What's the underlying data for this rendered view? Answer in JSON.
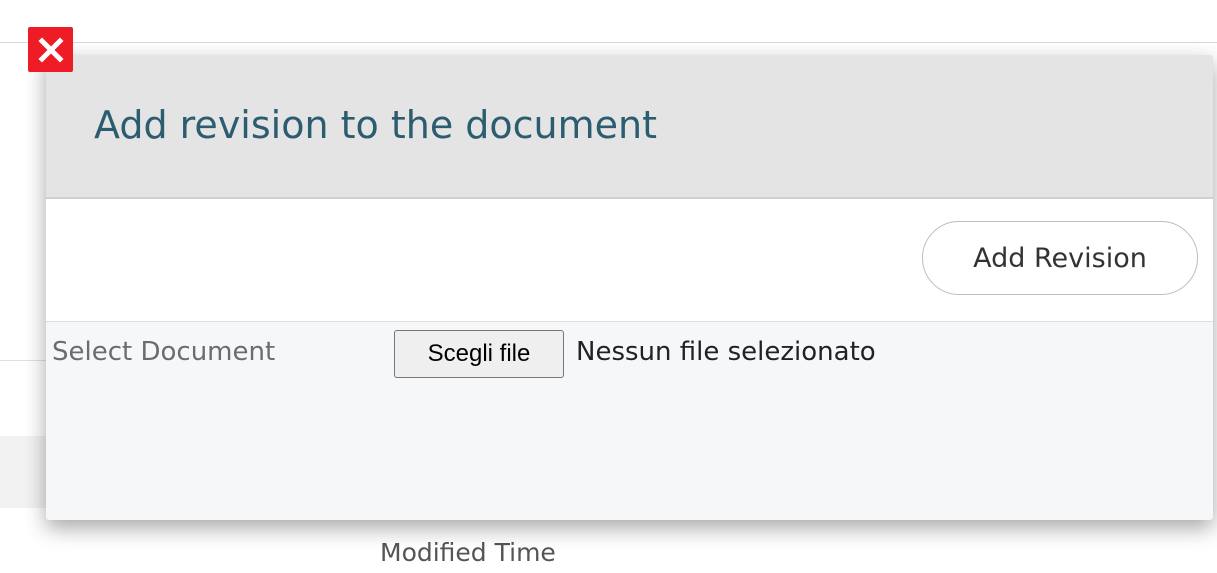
{
  "background": {
    "column_header": "Modified Time"
  },
  "close_button": {
    "icon": "close-icon",
    "color": "#ee1c25"
  },
  "modal": {
    "title": "Add revision to the document",
    "add_revision_label": "Add Revision",
    "form": {
      "select_label": "Select Document",
      "file_button_label": "Scegli file",
      "file_status": "Nessun file selezionato"
    }
  },
  "colors": {
    "title": "#2b5c70",
    "header_bg": "#e4e4e4",
    "body_bg": "#f6f7f9"
  }
}
